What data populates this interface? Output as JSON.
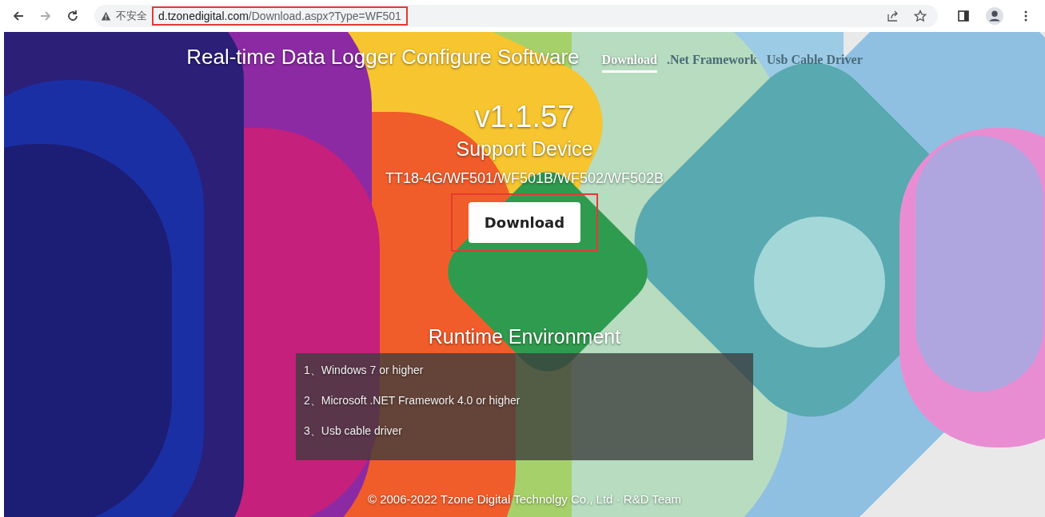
{
  "browser": {
    "security_label": "不安全",
    "url_host": "d.tzonedigital.com",
    "url_path": "/Download.aspx?Type=WF501",
    "url_highlighted": true
  },
  "header": {
    "title": "Real-time Data Logger Configure Software",
    "links": [
      {
        "label": "Download",
        "selected": true
      },
      {
        "label": ".Net Framework",
        "selected": false
      },
      {
        "label": "Usb Cable Driver",
        "selected": false
      }
    ]
  },
  "release": {
    "version": "v1.1.57",
    "support_title": "Support Device",
    "devices": "TT18-4G/WF501/WF501B/WF502/WF502B",
    "download_button": "Download",
    "download_highlighted": true
  },
  "runtime": {
    "title": "Runtime Environment",
    "requirements": [
      "1、Windows 7 or higher",
      "2、Microsoft .NET Framework 4.0 or higher",
      "3、Usb cable driver"
    ]
  },
  "footer": "© 2006-2022 Tzone Digital Technolgy Co., Ltd · R&D Team"
}
